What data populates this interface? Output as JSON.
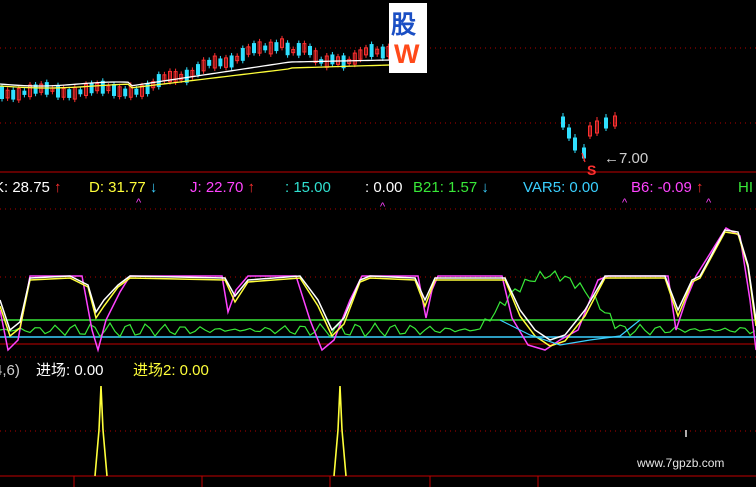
{
  "logo": {
    "char1": "股",
    "char2": "W"
  },
  "watermark": "www.7gpzb.com",
  "price_label": "7.00",
  "signal_label": "S",
  "indicator1": [
    {
      "text": "K: 28.75",
      "color": "#ffffff",
      "arrow": "↑",
      "arrow_color": "#ff3030"
    },
    {
      "text": "D: 31.77",
      "color": "#ffff3a",
      "arrow": "↓",
      "arrow_color": "#3ad0ff"
    },
    {
      "text": "J: 22.70",
      "color": "#ff44ff",
      "arrow": "↑",
      "arrow_color": "#ff3030"
    },
    {
      "text": ": 15.00",
      "color": "#30e0d0",
      "arrow": "",
      "arrow_color": ""
    },
    {
      "text": ": 0.00",
      "color": "#ffffff",
      "arrow": "",
      "arrow_color": ""
    },
    {
      "text": "B21: 1.57",
      "color": "#38e838",
      "arrow": "↓",
      "arrow_color": "#3ad0ff"
    },
    {
      "text": "VAR5: 0.00",
      "color": "#3ad0ff",
      "arrow": "",
      "arrow_color": ""
    },
    {
      "text": "B6: -0.09",
      "color": "#ff44ff",
      "arrow": "↑",
      "arrow_color": "#ff3030"
    },
    {
      "text": "HI",
      "color": "#38e838",
      "arrow": "",
      "arrow_color": ""
    }
  ],
  "indicator2": [
    {
      "text": "4,6)",
      "color": "#cfcfcf"
    },
    {
      "text": "进场: 0.00",
      "color": "#ffffff"
    },
    {
      "text": "进场2: 0.00",
      "color": "#ffff3a"
    }
  ],
  "colors": {
    "up": "#ff3030",
    "down": "#30e0ff",
    "ma_white": "#ffffff",
    "ma_yellow": "#ffff3a",
    "k": "#ffffff",
    "d": "#ffff3a",
    "j": "#ff44ff",
    "b21": "#38e838",
    "var5": "#3ad0ff",
    "grid": "#b00000",
    "signal": "#ffff3a"
  }
}
